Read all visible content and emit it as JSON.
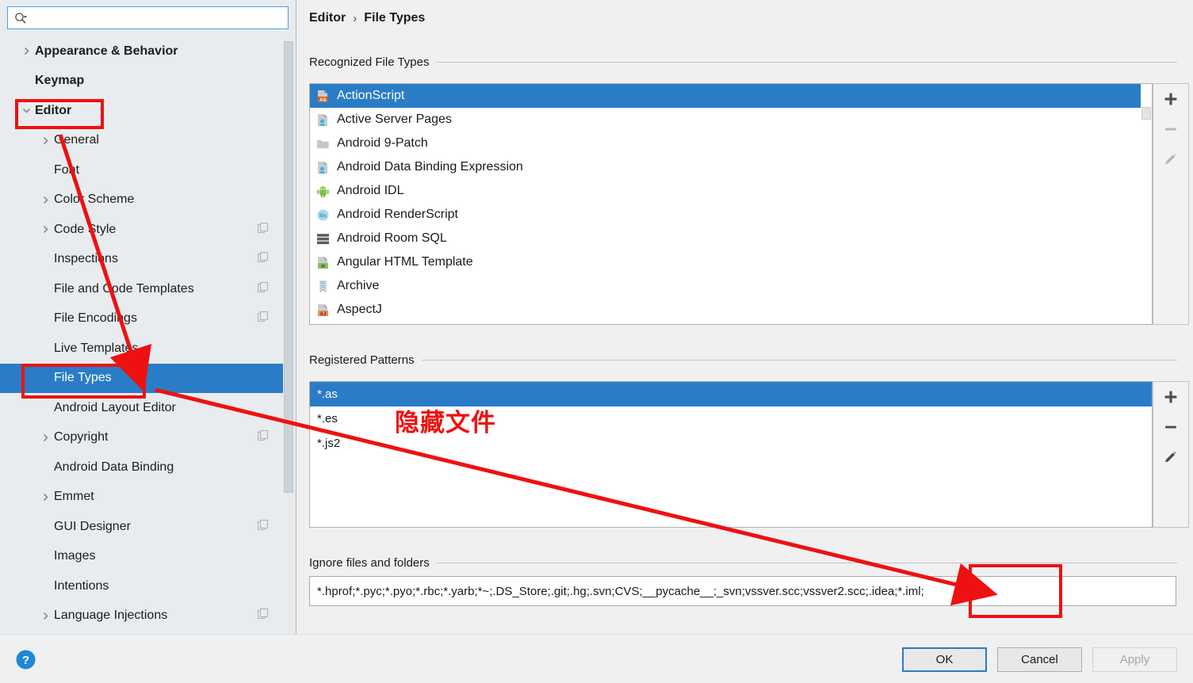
{
  "search": {
    "value": "",
    "placeholder": ""
  },
  "sidebar": {
    "items": [
      {
        "label": "Appearance & Behavior",
        "level": 1,
        "bold": true,
        "arrow": "right",
        "selected": false,
        "copy": false
      },
      {
        "label": "Keymap",
        "level": 1,
        "bold": true,
        "arrow": "none",
        "selected": false,
        "copy": false
      },
      {
        "label": "Editor",
        "level": 1,
        "bold": true,
        "arrow": "down",
        "selected": false,
        "copy": false
      },
      {
        "label": "General",
        "level": 2,
        "bold": false,
        "arrow": "right",
        "selected": false,
        "copy": false
      },
      {
        "label": "Font",
        "level": 2,
        "bold": false,
        "arrow": "none",
        "selected": false,
        "copy": false
      },
      {
        "label": "Color Scheme",
        "level": 2,
        "bold": false,
        "arrow": "right",
        "selected": false,
        "copy": false
      },
      {
        "label": "Code Style",
        "level": 2,
        "bold": false,
        "arrow": "right",
        "selected": false,
        "copy": true
      },
      {
        "label": "Inspections",
        "level": 2,
        "bold": false,
        "arrow": "none",
        "selected": false,
        "copy": true
      },
      {
        "label": "File and Code Templates",
        "level": 2,
        "bold": false,
        "arrow": "none",
        "selected": false,
        "copy": true
      },
      {
        "label": "File Encodings",
        "level": 2,
        "bold": false,
        "arrow": "none",
        "selected": false,
        "copy": true
      },
      {
        "label": "Live Templates",
        "level": 2,
        "bold": false,
        "arrow": "none",
        "selected": false,
        "copy": false
      },
      {
        "label": "File Types",
        "level": 2,
        "bold": false,
        "arrow": "none",
        "selected": true,
        "copy": false
      },
      {
        "label": "Android Layout Editor",
        "level": 2,
        "bold": false,
        "arrow": "none",
        "selected": false,
        "copy": false
      },
      {
        "label": "Copyright",
        "level": 2,
        "bold": false,
        "arrow": "right",
        "selected": false,
        "copy": true
      },
      {
        "label": "Android Data Binding",
        "level": 2,
        "bold": false,
        "arrow": "none",
        "selected": false,
        "copy": false
      },
      {
        "label": "Emmet",
        "level": 2,
        "bold": false,
        "arrow": "right",
        "selected": false,
        "copy": false
      },
      {
        "label": "GUI Designer",
        "level": 2,
        "bold": false,
        "arrow": "none",
        "selected": false,
        "copy": true
      },
      {
        "label": "Images",
        "level": 2,
        "bold": false,
        "arrow": "none",
        "selected": false,
        "copy": false
      },
      {
        "label": "Intentions",
        "level": 2,
        "bold": false,
        "arrow": "none",
        "selected": false,
        "copy": false
      },
      {
        "label": "Language Injections",
        "level": 2,
        "bold": false,
        "arrow": "right",
        "selected": false,
        "copy": true
      }
    ]
  },
  "breadcrumb": {
    "parent": "Editor",
    "separator": "›",
    "current": "File Types"
  },
  "recognized": {
    "title": "Recognized File Types",
    "items": [
      {
        "label": "ActionScript",
        "icon": "file-as-icon",
        "selected": true
      },
      {
        "label": "Active Server Pages",
        "icon": "file-asp-icon",
        "selected": false
      },
      {
        "label": "Android 9-Patch",
        "icon": "folder-icon",
        "selected": false
      },
      {
        "label": "Android Data Binding Expression",
        "icon": "file-asp-icon",
        "selected": false
      },
      {
        "label": "Android IDL",
        "icon": "android-robot-icon",
        "selected": false
      },
      {
        "label": "Android RenderScript",
        "icon": "circle-rs-icon",
        "selected": false
      },
      {
        "label": "Android Room SQL",
        "icon": "db-rows-icon",
        "selected": false
      },
      {
        "label": "Angular HTML Template",
        "icon": "file-h-icon",
        "selected": false
      },
      {
        "label": "Archive",
        "icon": "zip-archive-icon",
        "selected": false
      },
      {
        "label": "AspectJ",
        "icon": "file-aj-icon",
        "selected": false
      }
    ],
    "toolbar": [
      {
        "name": "add-file-type-button",
        "glyph": "+",
        "enabled": true
      },
      {
        "name": "remove-file-type-button",
        "glyph": "−",
        "enabled": false
      },
      {
        "name": "edit-file-type-button",
        "glyph": "pencil",
        "enabled": false
      }
    ]
  },
  "patterns": {
    "title": "Registered Patterns",
    "items": [
      {
        "label": "*.as",
        "selected": true
      },
      {
        "label": "*.es",
        "selected": false
      },
      {
        "label": "*.js2",
        "selected": false
      }
    ],
    "toolbar": [
      {
        "name": "add-pattern-button",
        "glyph": "+",
        "enabled": true
      },
      {
        "name": "remove-pattern-button",
        "glyph": "−",
        "enabled": true
      },
      {
        "name": "edit-pattern-button",
        "glyph": "pencil",
        "enabled": true
      }
    ]
  },
  "ignore": {
    "title": "Ignore files and folders",
    "value": "*.hprof;*.pyc;*.pyo;*.rbc;*.yarb;*~;.DS_Store;.git;.hg;.svn;CVS;__pycache__;_svn;vssver.scc;vssver2.scc;.idea;*.iml;",
    "placeholder": ""
  },
  "footer": {
    "help_label": "?",
    "ok_label": "OK",
    "cancel_label": "Cancel",
    "apply_label": "Apply"
  },
  "annotations": {
    "note_text": "隐藏文件",
    "color": "#ee1111"
  },
  "colors": {
    "selection_blue": "#2a7cc7",
    "sidebar_bg": "#e8ecef",
    "panel_bg": "#f0f0f0",
    "annotation_red": "#ee1111"
  }
}
